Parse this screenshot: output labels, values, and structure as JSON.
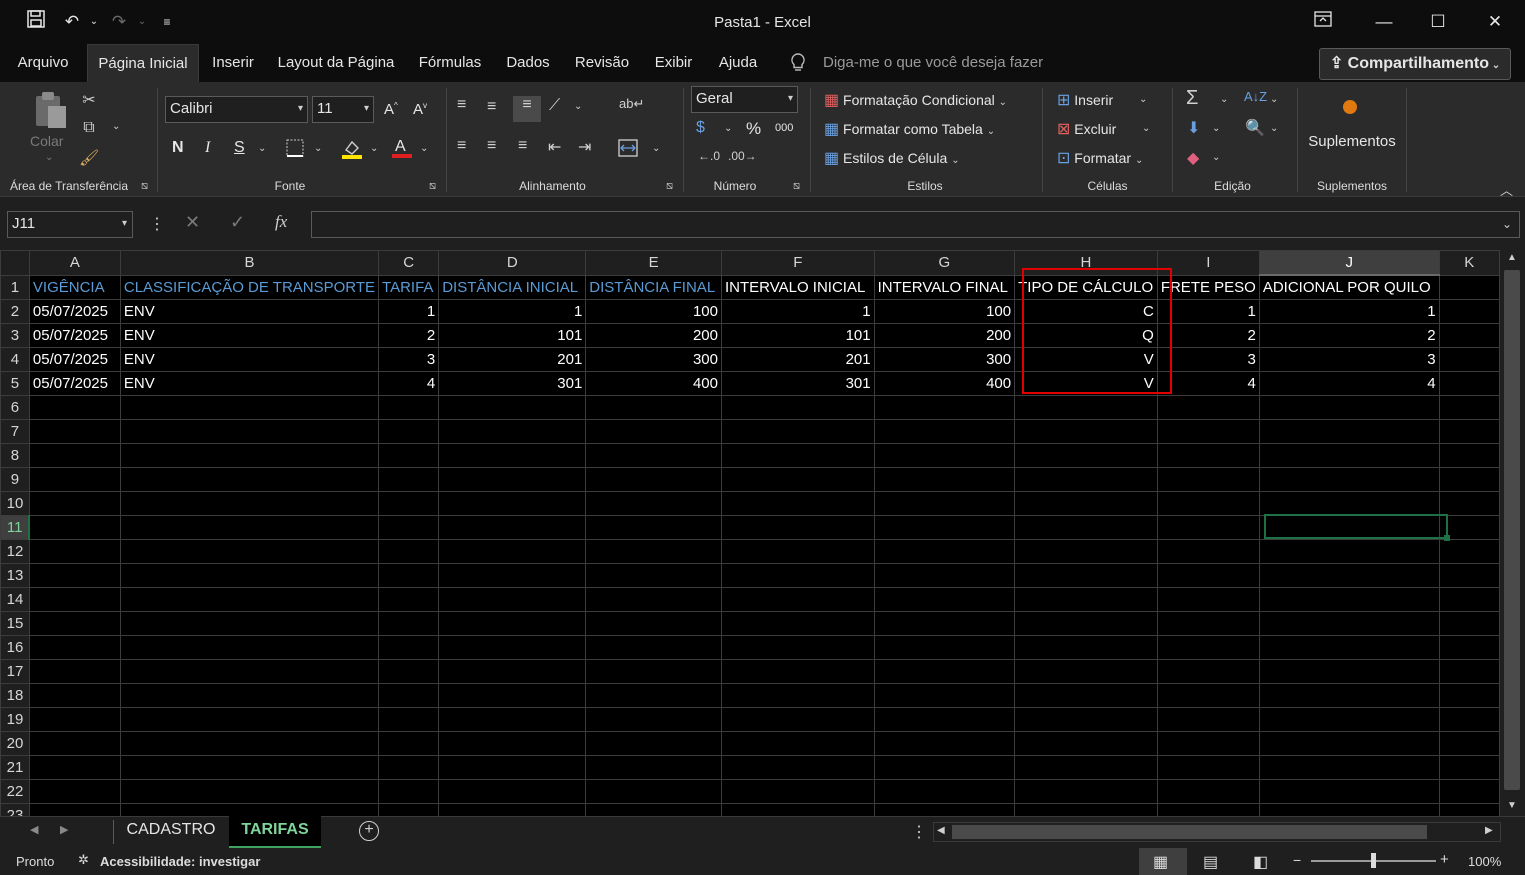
{
  "window": {
    "title": "Pasta1  -  Excel"
  },
  "menu": {
    "tabs": [
      "Arquivo",
      "Página Inicial",
      "Inserir",
      "Layout da Página",
      "Fórmulas",
      "Dados",
      "Revisão",
      "Exibir",
      "Ajuda"
    ],
    "active_tab": "Página Inicial",
    "tell_me": "Diga-me o que você deseja fazer",
    "share": "Compartilhamento"
  },
  "ribbon": {
    "clipboard": {
      "paste": "Colar",
      "label": "Área de Transferência"
    },
    "font": {
      "name": "Calibri",
      "size": "11",
      "bold": "N",
      "italic": "I",
      "underline": "S",
      "label": "Fonte"
    },
    "alignment": {
      "label": "Alinhamento"
    },
    "number": {
      "format": "Geral",
      "percent": "%",
      "thousands": "000",
      "label": "Número"
    },
    "styles": {
      "conditional": "Formatação Condicional",
      "table": "Formatar como Tabela",
      "cell_styles": "Estilos de Célula",
      "label": "Estilos"
    },
    "cells": {
      "insert": "Inserir",
      "delete": "Excluir",
      "format": "Formatar",
      "label": "Células"
    },
    "editing": {
      "label": "Edição"
    },
    "addins": {
      "button": "Suplementos",
      "label": "Suplementos"
    }
  },
  "formula_bar": {
    "name_box": "J11",
    "fx": "fx",
    "formula": ""
  },
  "grid": {
    "columns": [
      "A",
      "B",
      "C",
      "D",
      "E",
      "F",
      "G",
      "H",
      "I",
      "J",
      "K"
    ],
    "rows": [
      "1",
      "2",
      "3",
      "4",
      "5",
      "6",
      "7",
      "8",
      "9",
      "10",
      "11",
      "12",
      "13",
      "14",
      "15",
      "16",
      "17",
      "18",
      "19",
      "20",
      "21",
      "22",
      "23"
    ],
    "selected_cell": "J11",
    "header_row": [
      "VIGÊNCIA",
      "CLASSIFICAÇÃO DE TRANSPORTE",
      "TARIFA",
      "DISTÂNCIA INICIAL",
      "DISTÂNCIA FINAL",
      "INTERVALO INICIAL",
      "INTERVALO FINAL",
      "TIPO DE CÁLCULO",
      "FRETE PESO",
      "ADICIONAL POR QUILO"
    ],
    "data_rows": [
      [
        "05/07/2025",
        "ENV",
        "1",
        "1",
        "100",
        "1",
        "100",
        "C",
        "1",
        "1"
      ],
      [
        "05/07/2025",
        "ENV",
        "2",
        "101",
        "200",
        "101",
        "200",
        "Q",
        "2",
        "2"
      ],
      [
        "05/07/2025",
        "ENV",
        "3",
        "201",
        "300",
        "201",
        "300",
        "V",
        "3",
        "3"
      ],
      [
        "05/07/2025",
        "ENV",
        "4",
        "301",
        "400",
        "301",
        "400",
        "V",
        "4",
        "4"
      ]
    ],
    "highlight_color": "#e00000"
  },
  "sheets": {
    "tabs": [
      "CADASTRO",
      "TARIFAS"
    ],
    "active": "TARIFAS"
  },
  "status": {
    "ready": "Pronto",
    "accessibility": "Acessibilidade: investigar",
    "zoom": "100%"
  }
}
